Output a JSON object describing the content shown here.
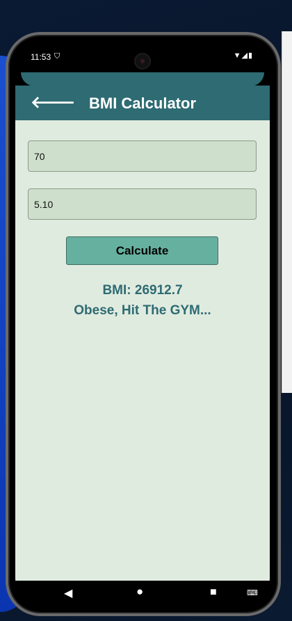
{
  "status_bar": {
    "time": "11:53",
    "left_icon": "shield-icon",
    "right_icons": [
      "wifi-icon",
      "signal-icon",
      "battery-icon"
    ]
  },
  "header": {
    "title": "BMI Calculator",
    "back_icon": "arrow-left-icon"
  },
  "form": {
    "weight_value": "70",
    "height_value": "5.10",
    "calculate_label": "Calculate"
  },
  "result": {
    "bmi": "BMI: 26912.7",
    "message": "Obese, Hit The GYM..."
  },
  "nav_bar": {
    "icons": [
      "back-icon",
      "home-icon",
      "recents-icon",
      "keyboard-icon"
    ]
  },
  "colors": {
    "primary": "#2e6b73",
    "background": "#e0ebdf",
    "input": "#cee0cb",
    "button": "#66b09f"
  }
}
